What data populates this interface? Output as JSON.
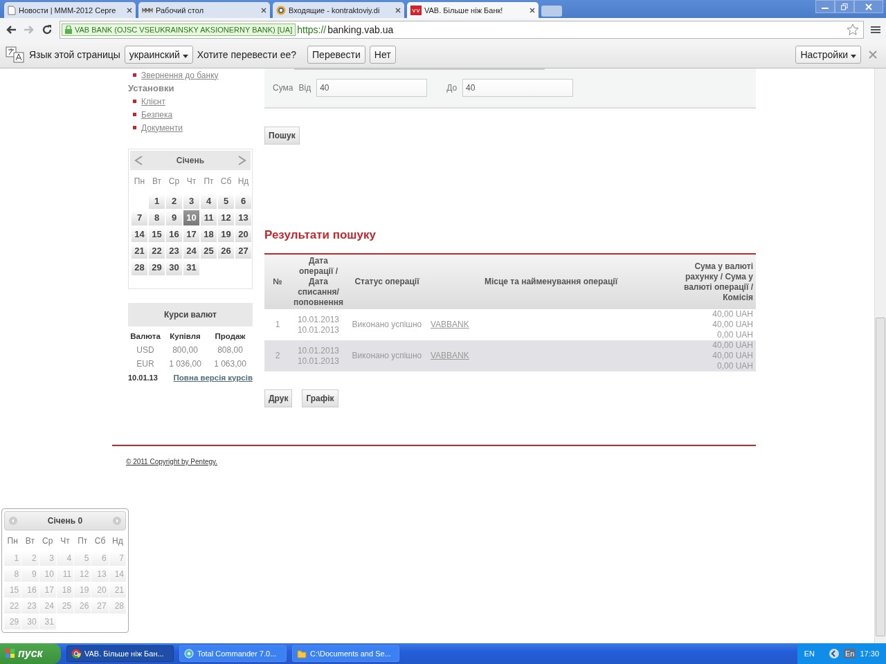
{
  "browser": {
    "tabs": [
      {
        "title": "Новости | МММ-2012 Серге",
        "selected": false,
        "kind": "page"
      },
      {
        "title": "Рабочий стол",
        "selected": false,
        "kind": "mmm"
      },
      {
        "title": "Входящие - kontraktoviy.di",
        "selected": false,
        "kind": "mail"
      },
      {
        "title": "VAB. Більше ніж Банк!",
        "selected": true,
        "kind": "bank"
      }
    ],
    "address": {
      "identity": "VAB BANK (OJSC VSEUKRAINSKY AKSIONERNY BANK) [UA]",
      "scheme": "https://",
      "host": "banking.vab.ua"
    },
    "translate_bar": {
      "label": "Язык этой страницы",
      "language": "украинский",
      "question": "Хотите перевести ее?",
      "translate_button": "Перевести",
      "no_button": "Нет",
      "settings": "Настройки"
    }
  },
  "sidebar": {
    "top_links": [
      "Звернення до банку"
    ],
    "section": "Установки",
    "section_links": [
      "Клієнт",
      "Безпека",
      "Документи"
    ],
    "calendar": {
      "month": "Січень",
      "weekdays": [
        "Пн",
        "Вт",
        "Ср",
        "Чт",
        "Пт",
        "Сб",
        "Нд"
      ],
      "weeks": [
        [
          {
            "day": "1",
            "selected": false
          },
          {
            "day": "2",
            "selected": false
          },
          {
            "day": "3",
            "selected": false
          },
          {
            "day": "4",
            "selected": false
          },
          {
            "day": "5",
            "selected": false
          },
          {
            "day": "6",
            "selected": false
          }
        ],
        [
          {
            "day": "7",
            "selected": false
          },
          {
            "day": "8",
            "selected": false
          },
          {
            "day": "9",
            "selected": false
          },
          {
            "day": "10",
            "selected": true
          },
          {
            "day": "11",
            "selected": false
          },
          {
            "day": "12",
            "selected": false
          },
          {
            "day": "13",
            "selected": false
          }
        ],
        [
          {
            "day": "14",
            "selected": false
          },
          {
            "day": "15",
            "selected": false
          },
          {
            "day": "16",
            "selected": false
          },
          {
            "day": "17",
            "selected": false
          },
          {
            "day": "18",
            "selected": false
          },
          {
            "day": "19",
            "selected": false
          },
          {
            "day": "20",
            "selected": false
          }
        ],
        [
          {
            "day": "21",
            "selected": false
          },
          {
            "day": "22",
            "selected": false
          },
          {
            "day": "23",
            "selected": false
          },
          {
            "day": "24",
            "selected": false
          },
          {
            "day": "25",
            "selected": false
          },
          {
            "day": "26",
            "selected": false
          },
          {
            "day": "27",
            "selected": false
          }
        ],
        [
          {
            "day": "28",
            "selected": false
          },
          {
            "day": "29",
            "selected": false
          },
          {
            "day": "30",
            "selected": false
          },
          {
            "day": "31",
            "selected": false
          }
        ]
      ]
    },
    "rates": {
      "title": "Курси валют",
      "columns": [
        "Валюта",
        "Купівля",
        "Продаж"
      ],
      "rows": [
        {
          "currency": "USD",
          "buy": "800,00",
          "sell": "808,00"
        },
        {
          "currency": "EUR",
          "buy": "1 036,00",
          "sell": "1 063,00"
        }
      ],
      "date": "10.01.13",
      "link": "Повна версія курсів"
    }
  },
  "filter": {
    "sum_label": "Сума",
    "from_label": "Від",
    "from_value": "40",
    "to_label": "До",
    "to_value": "40",
    "search_button": "Пошук"
  },
  "results": {
    "title": "Результати пошуку",
    "columns": [
      "№",
      "Дата операції / Дата списання/ поповнення",
      "Статус операції",
      "Місце та найменування операції",
      "Сума у валюті рахунку / Сума у валюті операції / Комісія"
    ],
    "rows": [
      {
        "number": "1",
        "dates": [
          "10.01.2013",
          "10.01.2013"
        ],
        "status": "Виконано успішно",
        "place": "VABBANK",
        "amounts": [
          "40,00 UAH",
          "40,00 UAH",
          "0,00 UAH"
        ]
      },
      {
        "number": "2",
        "dates": [
          "10.01.2013",
          "10.01.2013"
        ],
        "status": "Виконано успішно",
        "place": "VABBANK",
        "amounts": [
          "40,00 UAH",
          "40,00 UAH",
          "0,00 UAH"
        ]
      }
    ],
    "buttons": [
      "Друк",
      "Графік"
    ]
  },
  "footer": {
    "copyright": "© 2011 Copyright by Pentegy."
  },
  "popup_calendar": {
    "month": "Січень 0",
    "weekdays": [
      "Пн",
      "Вт",
      "Ср",
      "Чт",
      "Пт",
      "Сб",
      "Нд"
    ],
    "days": [
      "1",
      "2",
      "3",
      "4",
      "5",
      "6",
      "7",
      "8",
      "9",
      "10",
      "11",
      "12",
      "13",
      "14",
      "15",
      "16",
      "17",
      "18",
      "19",
      "20",
      "21",
      "22",
      "23",
      "24",
      "25",
      "26",
      "27",
      "28",
      "29",
      "30",
      "31"
    ]
  },
  "taskbar": {
    "start": "пуск",
    "items": [
      {
        "label": "VAB. Більше ніж Бан...",
        "selected": true,
        "kind": "browser"
      },
      {
        "label": "Total Commander 7.0...",
        "selected": false,
        "kind": "commander"
      },
      {
        "label": "C:\\Documents and Se...",
        "selected": false,
        "kind": "folder"
      }
    ],
    "language": "EN",
    "tray_language": "En",
    "clock": "17:30"
  }
}
